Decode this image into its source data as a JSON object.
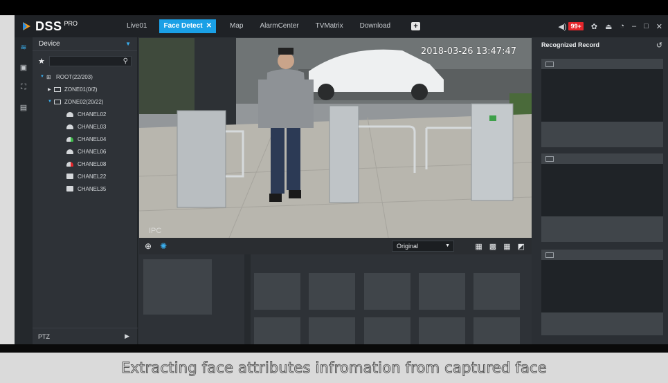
{
  "app": {
    "logo": "DSS",
    "logo_suffix": "PRO",
    "tabs": [
      {
        "label": "Live01",
        "active": false
      },
      {
        "label": "Face Detect",
        "active": true
      },
      {
        "label": "Map",
        "active": false
      },
      {
        "label": "AlarmCenter",
        "active": false
      },
      {
        "label": "TVMatrix",
        "active": false
      },
      {
        "label": "Download",
        "active": false
      }
    ],
    "alarm_badge": "99+",
    "accent_color": "#1aa0e6"
  },
  "device_panel": {
    "title": "Device",
    "search_placeholder": "",
    "tree": {
      "root": "ROOT(22/203)",
      "zone1": "ZONE01(0/2)",
      "zone2": "ZONE02(20/22)",
      "channels": [
        "CHANEL02",
        "CHANEL03",
        "CHANEL04",
        "CHANEL06",
        "CHANEL08",
        "CHANEL22",
        "CHANEL35"
      ]
    },
    "ptz_label": "PTZ"
  },
  "video": {
    "timestamp": "2018-03-26 13:47:47",
    "overlay_label": "IPC",
    "stream_mode": "Original"
  },
  "recognized": {
    "title": "Recognized Record"
  },
  "caption": "Extracting face attributes infromation from captured face"
}
